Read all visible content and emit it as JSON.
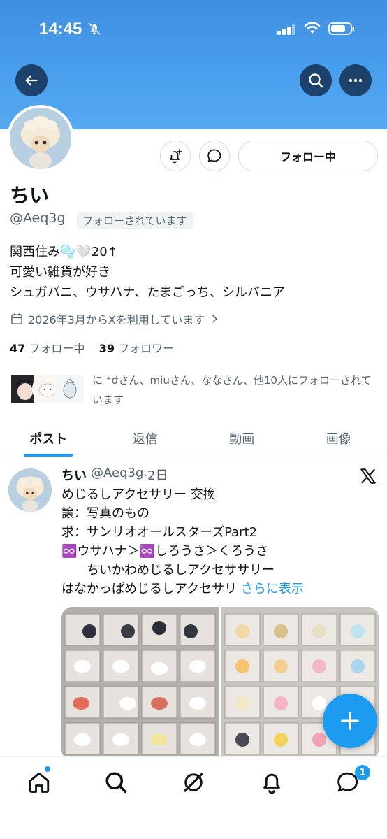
{
  "status_bar": {
    "time": "14:45"
  },
  "profile": {
    "display_name": "ちい",
    "handle": "@Aeq3g",
    "follows_you_label": "フォローされています",
    "follow_button_label": "フォロー中",
    "bio_lines": [
      "関西住み🫧🤍20↑",
      "可愛い雑貨が好き",
      "シュガバニ、ウサハナ、たまごっち、シルバニア"
    ],
    "joined": "2026年3月からXを利用しています",
    "following_count": "47",
    "following_label": "フォロー中",
    "followers_count": "39",
    "followers_label": "フォロワー",
    "followers_you_know": "に ⁺ժさん、miuさん、ななさん、他10人にフォローされています"
  },
  "tabs": [
    "ポスト",
    "返信",
    "動画",
    "画像"
  ],
  "post": {
    "name": "ちい",
    "handle": "@Aeq3g",
    "time": "·2日",
    "lines": [
      "めじるしアクセサリー 交換",
      "譲：写真のもの",
      "求：サンリオオールスターズPart2",
      "♾️ウサハナ＞♾️しろうさ＞くろうさ",
      "　　ちいかわめじるしアクセササリー",
      "はなかっぱめじるしアクセサリ"
    ],
    "show_more": "さらに表示"
  },
  "nav": {
    "messages_badge": "1"
  },
  "colors": {
    "accent": "#1d9bf0",
    "banner": "#4aa0ee"
  }
}
